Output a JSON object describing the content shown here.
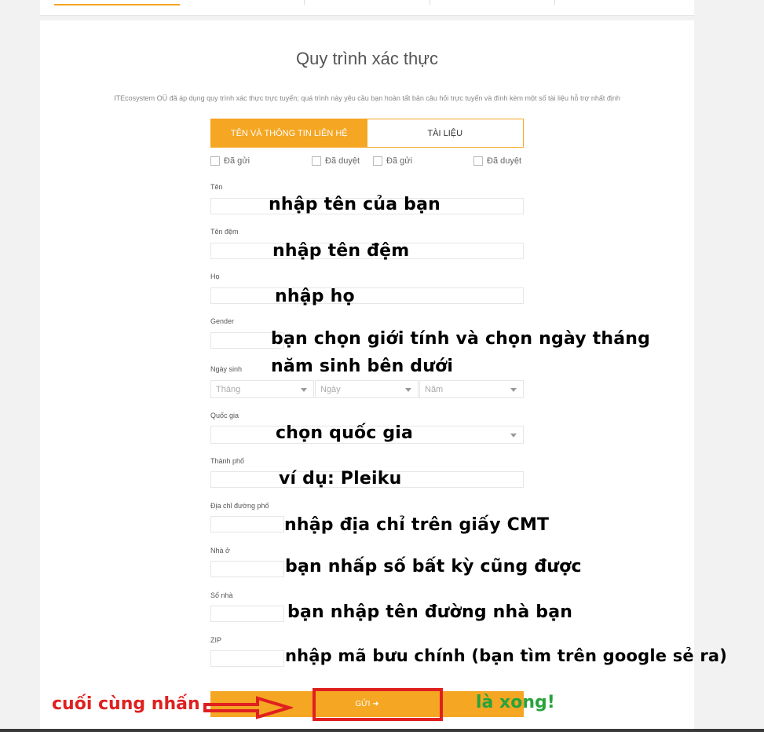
{
  "form": {
    "title": "Quy trình xác thực",
    "subtitle": "ITEcosystem OÜ đã áp dụng quy trình xác thực trực tuyến; quá trình này yêu cầu bạn hoàn tất bản câu hỏi trực tuyến và đính kèm một số tài liệu hỗ trợ nhất định",
    "tabs": [
      {
        "label": "TÊN VÀ THÔNG TIN LIÊN HỆ"
      },
      {
        "label": "TÀI LIỆU"
      }
    ],
    "status": [
      {
        "label": "Đã gửi"
      },
      {
        "label": "Đã duyệt"
      },
      {
        "label": "Đã gửi"
      },
      {
        "label": "Đã duyệt"
      }
    ],
    "fields": {
      "first_name": "Tên",
      "middle_name": "Tên đệm",
      "last_name": "Họ",
      "gender": "Gender",
      "dob": "Ngày sinh",
      "country": "Quốc gia",
      "city": "Thành phố",
      "street": "Địa chỉ đường phố",
      "house": "Nhà ở",
      "house_no": "Số nhà",
      "zip": "ZIP"
    },
    "dob_selects": {
      "month": "Tháng",
      "day": "Ngày",
      "year": "Năm"
    },
    "submit_label": "GỬI ➜"
  },
  "annotations": {
    "first_name": "nhập tên của bạn",
    "middle_name": "nhập tên đệm",
    "last_name": "nhập họ",
    "gender_line1": "bạn chọn giới tính và chọn ngày tháng",
    "gender_line2": "năm sinh bên dưới",
    "country": "chọn quốc gia",
    "city": "ví dụ: Pleiku",
    "street": "nhập địa chỉ trên giấy CMT",
    "house": "bạn nhấp số bất kỳ  cũng được",
    "house_no": "bạn nhập tên đường nhà bạn",
    "zip": "nhập mã bưu chính (bạn tìm trên google sẻ ra)",
    "final": "cuối cùng nhấn",
    "done": "là xong!"
  },
  "colors": {
    "accent": "#f5a623",
    "annotation_red": "#e02020",
    "annotation_green": "#27a33c"
  }
}
